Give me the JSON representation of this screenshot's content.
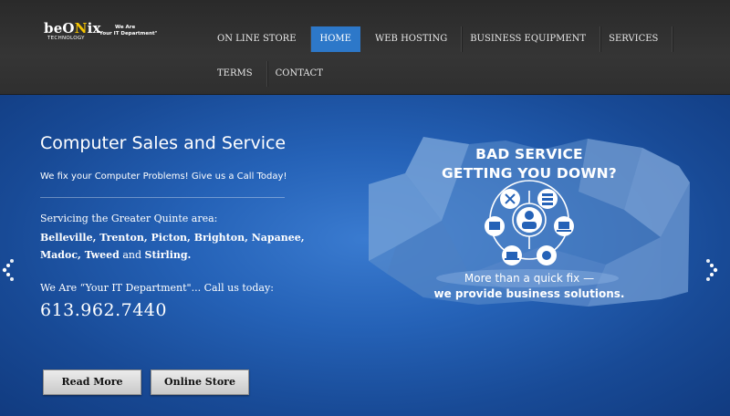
{
  "logo": {
    "name_part1": "beO",
    "name_highlight": "N",
    "name_part2": "ix",
    "subtitle": "TECHNOLOGY",
    "tagline_line1": "We Are",
    "tagline_line2": "\"Your IT Department\""
  },
  "nav": {
    "row1": [
      {
        "label": "ON LINE STORE",
        "active": false
      },
      {
        "label": "HOME",
        "active": true
      },
      {
        "label": "WEB HOSTING",
        "active": false
      },
      {
        "label": "BUSINESS EQUIPMENT",
        "active": false
      },
      {
        "label": "SERVICES",
        "active": false
      }
    ],
    "row2": [
      {
        "label": "TERMS",
        "active": false
      },
      {
        "label": "CONTACT",
        "active": false
      }
    ],
    "active_color": "#2d78c9"
  },
  "hero": {
    "title": "Computer Sales and Service",
    "tagline": "We fix your Computer Problems! Give us a Call Today!",
    "service_intro": "Servicing the Greater Quinte area:",
    "areas_bold_1": "Belleville, Trenton, Picton, Brighton, Napanee, Madoc, Tweed",
    "areas_and": "and",
    "areas_bold_2": "Stirling.",
    "call_text": "We Are “Your IT Department\"... Call us today:",
    "phone": "613.962.7440",
    "buttons": {
      "read_more": "Read More",
      "online_store": "Online Store"
    },
    "accent_bg": "#2562b7"
  },
  "promo": {
    "title_line1": "BAD SERVICE",
    "title_line2": "GETTING YOU DOWN?",
    "subtitle_line1": "More than a quick fix —",
    "subtitle_line2": "we provide business solutions."
  },
  "icons": {
    "slider_prev": "chevron-left-icon",
    "slider_next": "chevron-right-icon",
    "center": "headset-person-icon",
    "ring": [
      "tools-icon",
      "server-icon",
      "computer-icon",
      "laptop-settings-icon",
      "laptop-icon",
      "globe-icon"
    ]
  }
}
